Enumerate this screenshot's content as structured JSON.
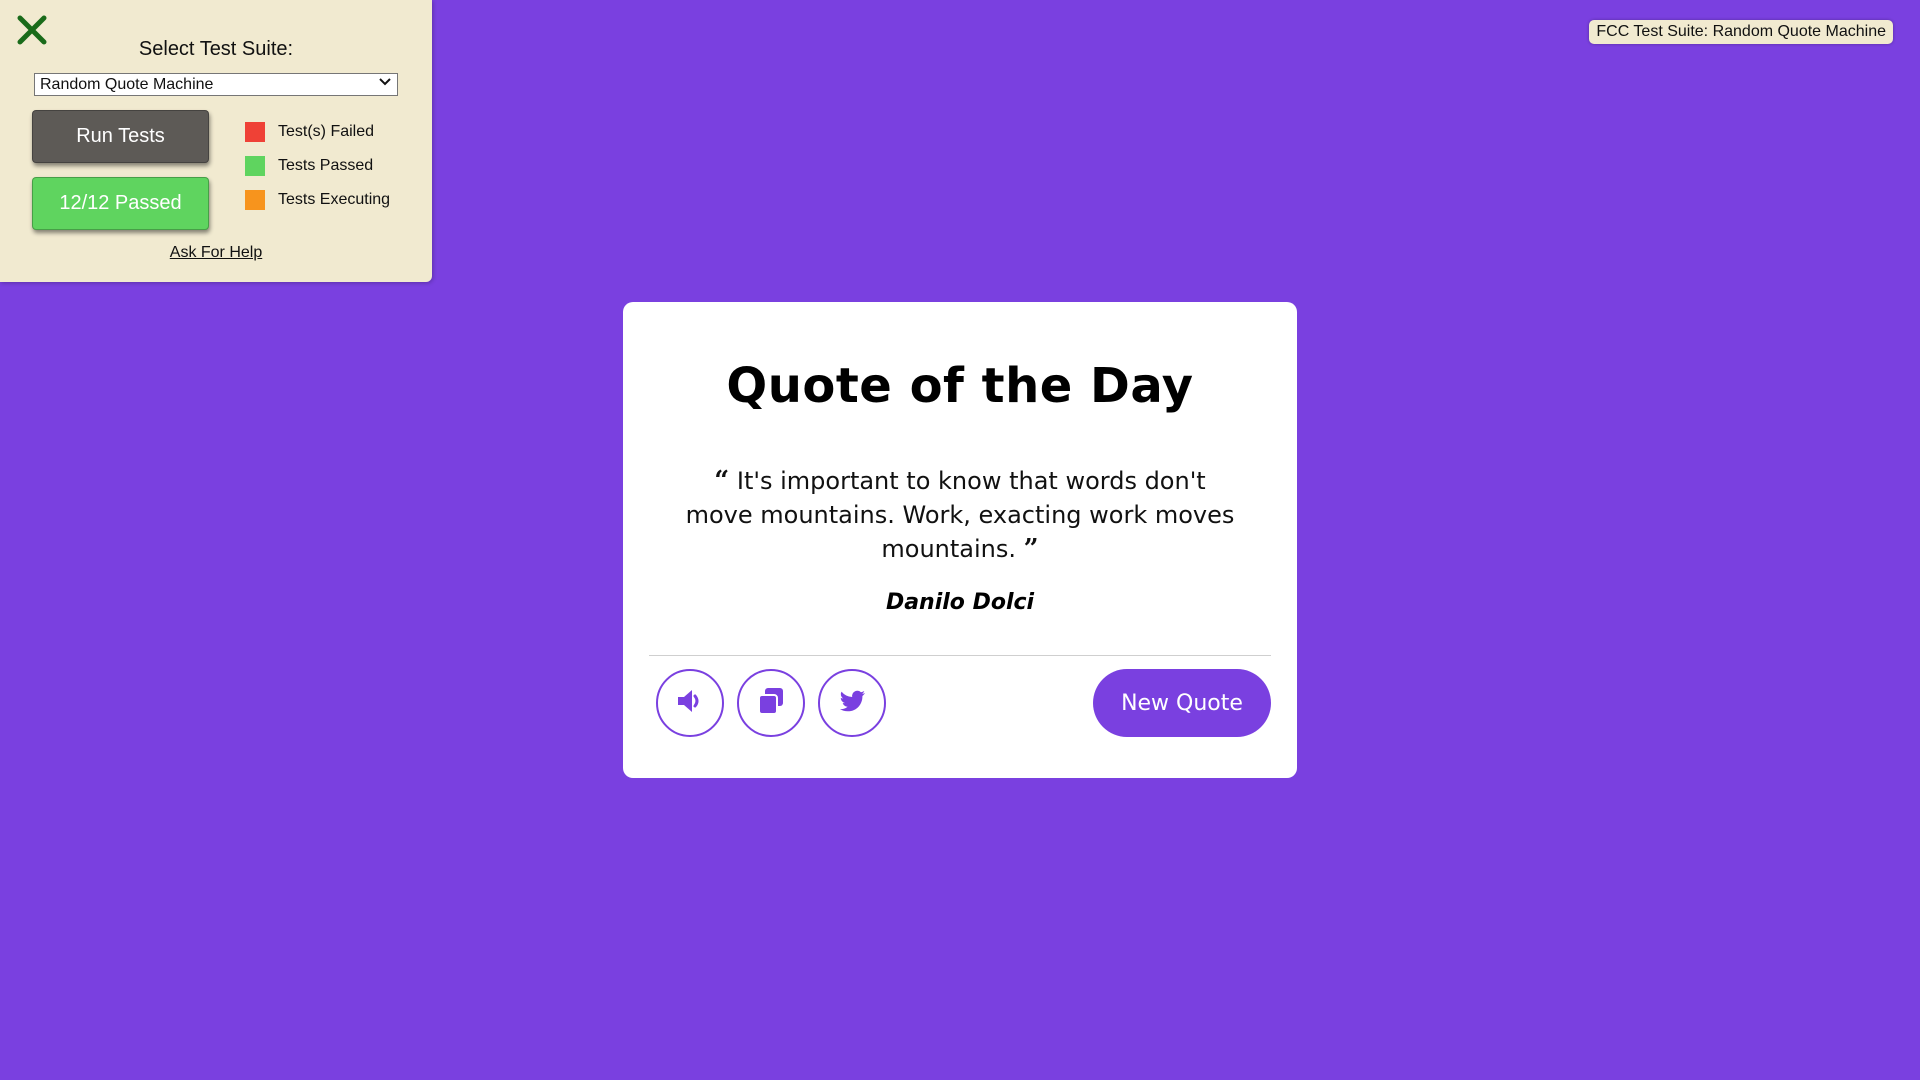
{
  "fcc_panel": {
    "suite_label": "Select Test Suite:",
    "selected_suite": "Random Quote Machine",
    "run_button": "Run Tests",
    "result_button": "12/12 Passed",
    "legend": [
      {
        "label": "Test(s) Failed",
        "color": "#ef4136"
      },
      {
        "label": "Tests Passed",
        "color": "#5fd45f"
      },
      {
        "label": "Tests Executing",
        "color": "#f7941d"
      }
    ],
    "help_link": "Ask For Help",
    "close_icon": "close-x-icon"
  },
  "badge": {
    "text": "FCC Test Suite: Random Quote Machine"
  },
  "card": {
    "title": "Quote of the Day",
    "quote_text": "It's important to know that words don't move mountains. Work, exacting work moves mountains.",
    "open_quote": "“",
    "close_quote": "”",
    "author": "Danilo Dolci",
    "actions": [
      {
        "name": "speak",
        "icon": "speaker-icon"
      },
      {
        "name": "copy",
        "icon": "copy-icon"
      },
      {
        "name": "tweet",
        "icon": "twitter-icon"
      }
    ],
    "new_quote_button": "New Quote"
  },
  "colors": {
    "background": "#7a40e0",
    "accent": "#7a40e0",
    "panel": "#f1ead0"
  }
}
